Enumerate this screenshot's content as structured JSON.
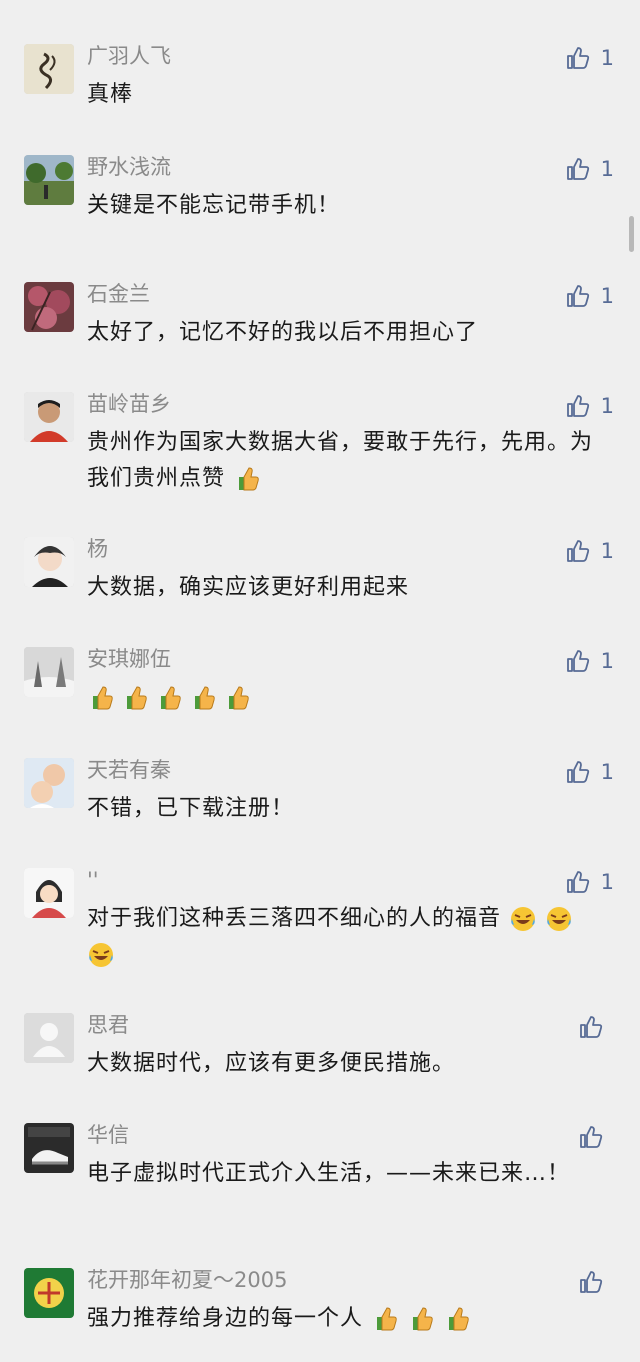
{
  "comments": [
    {
      "name": "广羽人飞",
      "text": "真棒",
      "likes": "1",
      "avatar": "calligraphy-avatar"
    },
    {
      "name": "野水浅流",
      "text": "关键是不能忘记带手机！",
      "likes": "1",
      "avatar": "park-photo-avatar"
    },
    {
      "name": "石金兰",
      "text": "太好了，记忆不好的我以后不用担心了",
      "likes": "1",
      "avatar": "blossom-tree-avatar"
    },
    {
      "name": "苗岭苗乡",
      "text": "贵州作为国家大数据大省，要敢于先行，先用。为我们贵州点赞",
      "likes": "1",
      "avatar": "man-portrait-avatar",
      "emoji": [
        "thumbs-up-emoji"
      ]
    },
    {
      "name": "杨",
      "text": "大数据，确实应该更好利用起来",
      "likes": "1",
      "avatar": "anime-boy-avatar"
    },
    {
      "name": "安琪娜伍",
      "text": "",
      "likes": "1",
      "avatar": "snow-scene-avatar",
      "emoji": [
        "thumbs-up-emoji",
        "thumbs-up-emoji",
        "thumbs-up-emoji",
        "thumbs-up-emoji",
        "thumbs-up-emoji"
      ]
    },
    {
      "name": "天若有秦",
      "text": "不错，已下载注册！",
      "likes": "1",
      "avatar": "babies-photo-avatar"
    },
    {
      "name": "''",
      "text": "对于我们这种丢三落四不细心的人的福音",
      "likes": "1",
      "avatar": "cartoon-girl-avatar",
      "emoji": [
        "laugh-cry-emoji",
        "laugh-cry-emoji",
        "laugh-cry-emoji"
      ]
    },
    {
      "name": "思君",
      "text": "大数据时代，应该有更多便民措施。",
      "likes": "",
      "avatar": "default-user-avatar"
    },
    {
      "name": "华信",
      "text": "电子虚拟时代正式介入生活，——未来已来…！",
      "likes": "",
      "avatar": "sneaker-photo-avatar"
    },
    {
      "name": "花开那年初夏～2005",
      "text": "强力推荐给身边的每一个人",
      "likes": "",
      "avatar": "green-logo-avatar",
      "emoji": [
        "thumbs-up-emoji",
        "thumbs-up-emoji",
        "thumbs-up-emoji"
      ]
    }
  ],
  "colors": {
    "background": "#efefef",
    "name": "#8a8a8a",
    "text": "#1a1a1a",
    "like": "#576b95"
  }
}
